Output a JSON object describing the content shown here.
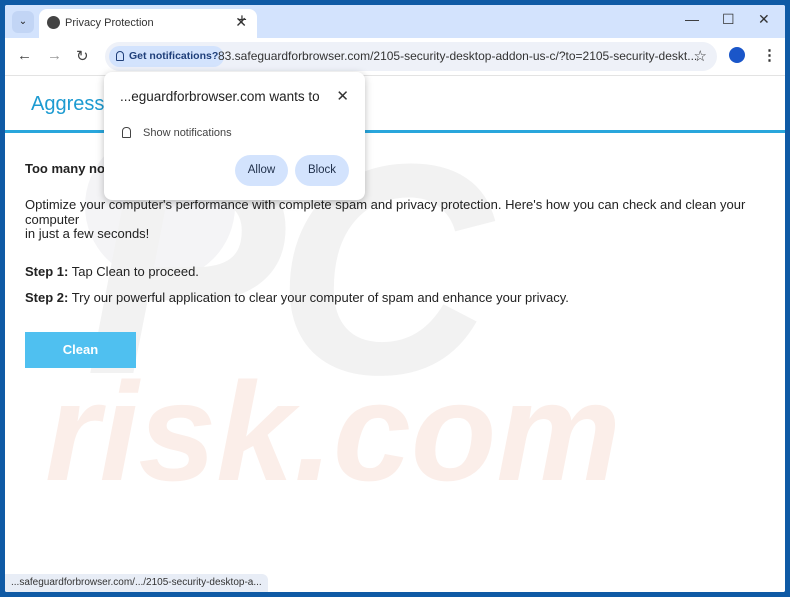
{
  "browser": {
    "tab_title": "Privacy Protection",
    "url": "83.safeguardforbrowser.com/2105-security-desktop-addon-us-c/?to=2105-security-deskt...",
    "notification_chip": "Get notifications?",
    "status_url": "...safeguardforbrowser.com/.../2105-security-desktop-a..."
  },
  "popup": {
    "title": "...eguardforbrowser.com wants to",
    "permission": "Show notifications",
    "allow": "Allow",
    "block": "Block"
  },
  "page": {
    "heading": "Aggressi",
    "subheading": "Too many not",
    "intro_1": "Optimize your computer's performance with complete spam and privacy protection. Here's how you can check and clean your computer",
    "intro_2": "in just a few seconds!",
    "step1_label": "Step 1:",
    "step1_text": " Tap Clean to proceed.",
    "step2_label": "Step 2:",
    "step2_text": " Try our powerful application to clear your computer of spam and enhance your privacy.",
    "clean_button": "Clean"
  },
  "watermark": {
    "top": "PC",
    "bottom": "risk.com"
  },
  "colors": {
    "accent": "#29a6dc",
    "button": "#4fc0f0",
    "frame": "#0f5aa5"
  }
}
